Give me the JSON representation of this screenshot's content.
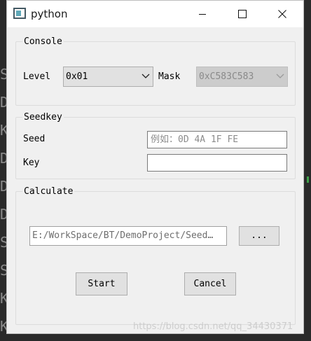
{
  "background": {
    "editor_letters": [
      "S",
      "D",
      "K",
      "D",
      "D",
      "D",
      "S",
      "S",
      "K",
      "K"
    ]
  },
  "window": {
    "title": "python"
  },
  "titlebar_icons": {
    "app": "app-window-icon",
    "minimize": "minimize-icon",
    "maximize": "maximize-icon",
    "close": "close-icon"
  },
  "console": {
    "title": "Console",
    "level_label": "Level",
    "level_value": "0x01",
    "mask_label": "Mask",
    "mask_value": "0xC583C583"
  },
  "seedkey": {
    "title": "Seedkey",
    "seed_label": "Seed",
    "seed_placeholder": "例如：0D 4A 1F FE",
    "seed_value": "",
    "key_label": "Key",
    "key_value": ""
  },
  "calculate": {
    "title": "Calculate",
    "path_value": "E:/WorkSpace/BT/DemoProject/Seed…",
    "browse_label": "...",
    "start_label": "Start",
    "cancel_label": "Cancel"
  },
  "watermark": "https://blog.csdn.net/qq_34430371",
  "colors": {
    "window_bg": "#f0f0f0",
    "titlebar_bg": "#ffffff",
    "button_bg": "#e1e1e1",
    "disabled_bg": "#cccccc",
    "backdrop": "#2a2a2a"
  }
}
